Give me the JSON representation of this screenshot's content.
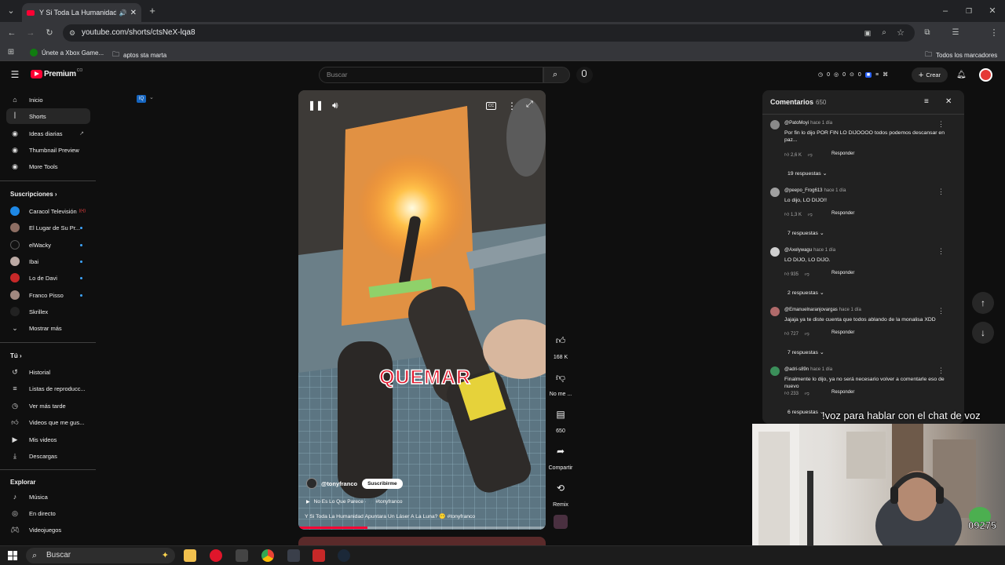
{
  "browser": {
    "tab_title": "Y Si Toda La Humanidad Ap",
    "url": "youtube.com/shorts/ctsNeX-lqa8",
    "bookmarks": [
      "Únete a Xbox Game...",
      "aptos sta marta"
    ],
    "all_bookmarks": "Todos los marcadores",
    "profile_initial": "J"
  },
  "youtube": {
    "logo": "Premium",
    "logo_region": "CO",
    "search_placeholder": "Buscar",
    "header_counts": [
      "0",
      "0",
      "0"
    ],
    "create_label": "Crear"
  },
  "sidebar": {
    "main": [
      "Inicio",
      "Shorts",
      "Ideas diarias",
      "Thumbnail Preview",
      "More Tools"
    ],
    "subs_heading": "Suscripciones",
    "subs": [
      "Caracol Televisión",
      "El Lugar de Su Pr...",
      "elWacky",
      "Ibai",
      "Lo de Davi",
      "Franco Pisso",
      "Skrillex"
    ],
    "show_more": "Mostrar más",
    "you_heading": "Tú",
    "you": [
      "Historial",
      "Listas de reproducc...",
      "Ver más tarde",
      "Videos que me gus...",
      "Mis videos",
      "Descargas"
    ],
    "explore_heading": "Explorar",
    "explore": [
      "Música",
      "En directo",
      "Videojuegos"
    ]
  },
  "video": {
    "overlay_text": "QUEMAR",
    "channel": "@tonyfranco",
    "subscribe": "Suscribirme",
    "music": "No Es Lo Que Parece · 🎵 #tonyfranco",
    "title": "Y Si Toda La Humanidad Apuntara Un Láser A La Luna? 😶 #tonyfranco",
    "likes": "168 K",
    "dislike": "No me ...",
    "comments": "650",
    "share": "Compartir",
    "remix": "Remix",
    "progress": 0.28
  },
  "comments": {
    "title": "Comentarios",
    "count": "650",
    "reply_label": "Responder",
    "items": [
      {
        "author": "@PatoMoyi",
        "time": "hace 1 día",
        "text": "Por fin lo dijo POR FIN LO DIJOOOO todos podemos descansar en paz...",
        "likes": "2,6 K",
        "replies": "19 respuestas",
        "color": "#8a8a8a"
      },
      {
        "author": "@peepo_Frog613",
        "time": "hace 1 día",
        "text": "Lo dijo, LO DIJO!!",
        "likes": "1,3 K",
        "replies": "7 respuestas",
        "color": "#a0a0a0"
      },
      {
        "author": "@Axelywagu",
        "time": "hace 1 día",
        "text": "LO DIJO, LO DIJO.",
        "likes": "935",
        "replies": "2 respuestas",
        "color": "#d0d0d0"
      },
      {
        "author": "@Emanuelnaranjovargas",
        "time": "hace 1 día",
        "text": "Jajaja ya te diste cuenta que todos ablando de la monalisa XDD",
        "likes": "727",
        "replies": "7 respuestas",
        "color": "#b06a6a"
      },
      {
        "author": "@adri-s89n",
        "time": "hace 1 día",
        "text": "Finalmente lo dijo, ya no será necesario volver a comentarle eso de nuevo",
        "likes": "233",
        "replies": "6 respuestas",
        "color": "#3b8f5a"
      }
    ]
  },
  "stream": {
    "caption": "!voz para hablar con el chat de voz",
    "badge": "09275"
  },
  "taskbar": {
    "search": "Buscar"
  }
}
